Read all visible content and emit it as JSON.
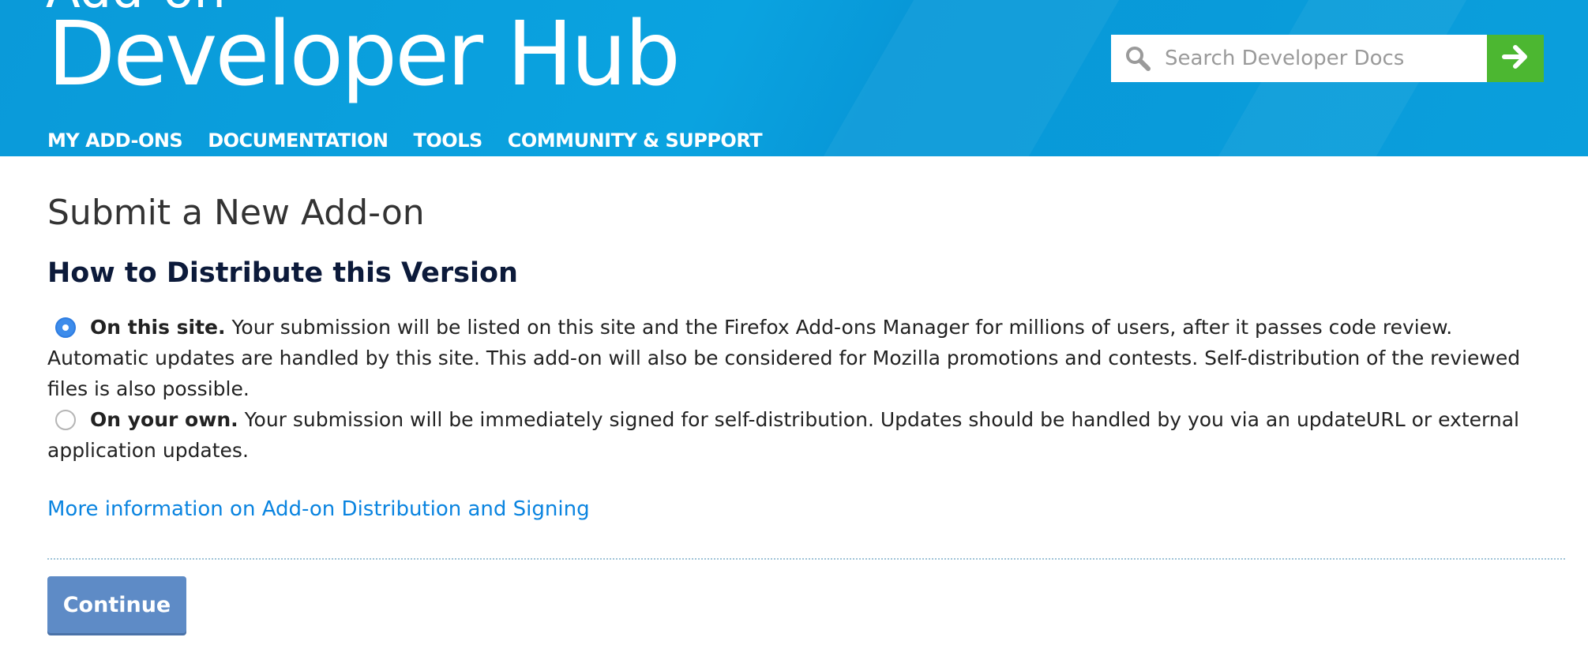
{
  "header": {
    "brand_top": "Add-on",
    "brand_title": "Developer Hub",
    "search": {
      "placeholder": "Search Developer Docs",
      "value": "",
      "icon": "search-icon",
      "submit_icon": "arrow-right-icon"
    },
    "nav": [
      {
        "label": "MY ADD-ONS"
      },
      {
        "label": "DOCUMENTATION"
      },
      {
        "label": "TOOLS"
      },
      {
        "label": "COMMUNITY & SUPPORT"
      }
    ]
  },
  "main": {
    "page_title": "Submit a New Add-on",
    "section_title": "How to Distribute this Version",
    "options": [
      {
        "label": "On this site.",
        "description": " Your submission will be listed on this site and the Firefox Add-ons Manager for millions of users, after it passes code review. Automatic updates are handled by this site. This add-on will also be considered for Mozilla promotions and contests. Self-distribution of the reviewed files is also possible.",
        "selected": true
      },
      {
        "label": "On your own.",
        "description": " Your submission will be immediately signed for self-distribution. Updates should be handled by you via an updateURL or external application updates.",
        "selected": false
      }
    ],
    "more_info_link": "More information on Add-on Distribution and Signing",
    "continue_label": "Continue"
  },
  "colors": {
    "header_bg": "#0a9fdc",
    "search_button": "#4cb731",
    "link": "#0a84e0",
    "radio_selected": "#3d8ceb",
    "continue_button": "#5e8bc6"
  }
}
